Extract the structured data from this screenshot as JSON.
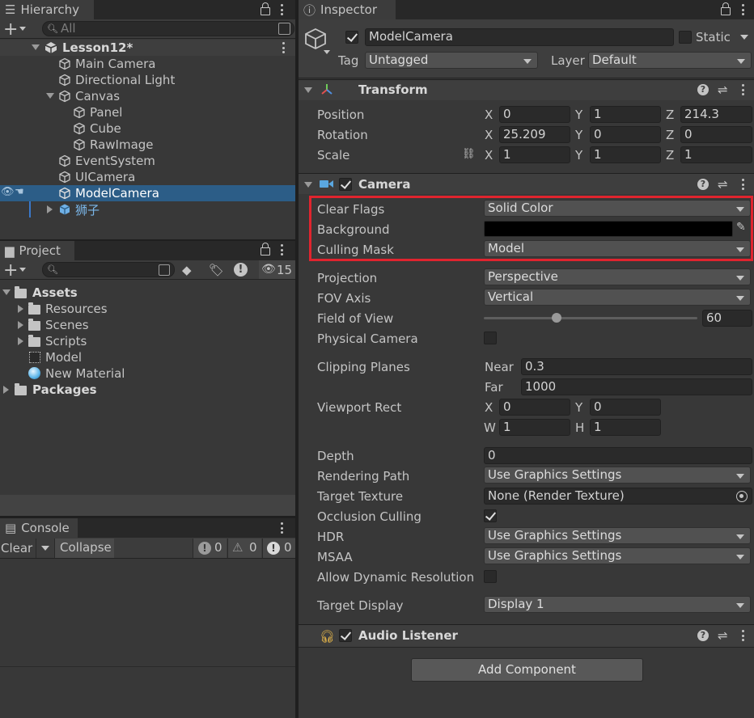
{
  "hierarchy": {
    "tab": "Hierarchy",
    "search_placeholder": "All",
    "scene": "Lesson12*",
    "items": [
      {
        "label": "Main Camera"
      },
      {
        "label": "Directional Light"
      },
      {
        "label": "Canvas"
      },
      {
        "label": "Panel"
      },
      {
        "label": "Cube"
      },
      {
        "label": "RawImage"
      },
      {
        "label": "EventSystem"
      },
      {
        "label": "UICamera"
      },
      {
        "label": "ModelCamera"
      },
      {
        "label": "狮子"
      }
    ]
  },
  "project": {
    "tab": "Project",
    "hidden_count": "15",
    "items": [
      {
        "label": "Assets"
      },
      {
        "label": "Resources"
      },
      {
        "label": "Scenes"
      },
      {
        "label": "Scripts"
      },
      {
        "label": "Model"
      },
      {
        "label": "New Material"
      },
      {
        "label": "Packages"
      }
    ]
  },
  "console": {
    "tab": "Console",
    "clear": "Clear",
    "collapse": "Collapse",
    "errors": "0",
    "warnings": "0",
    "messages": "0"
  },
  "inspector": {
    "tab": "Inspector",
    "object_name": "ModelCamera",
    "static_label": "Static",
    "tag_label": "Tag",
    "tag_value": "Untagged",
    "layer_label": "Layer",
    "layer_value": "Default",
    "transform": {
      "title": "Transform",
      "position_label": "Position",
      "rotation_label": "Rotation",
      "scale_label": "Scale",
      "axis_x": "X",
      "axis_y": "Y",
      "axis_z": "Z",
      "position": {
        "x": "0",
        "y": "1",
        "z": "214.3"
      },
      "rotation": {
        "x": "25.209",
        "y": "0",
        "z": "0"
      },
      "scale": {
        "x": "1",
        "y": "1",
        "z": "1"
      }
    },
    "camera": {
      "title": "Camera",
      "clear_flags_label": "Clear Flags",
      "clear_flags": "Solid Color",
      "background_label": "Background",
      "culling_mask_label": "Culling Mask",
      "culling_mask": "Model",
      "projection_label": "Projection",
      "projection": "Perspective",
      "fov_axis_label": "FOV Axis",
      "fov_axis": "Vertical",
      "fov_label": "Field of View",
      "fov_value": "60",
      "fov_slider_fraction": 0.34,
      "physical_label": "Physical Camera",
      "clipping_label": "Clipping Planes",
      "near_label": "Near",
      "near": "0.3",
      "far_label": "Far",
      "far": "1000",
      "viewport_label": "Viewport Rect",
      "vp_x_label": "X",
      "vp_y_label": "Y",
      "vp_w_label": "W",
      "vp_h_label": "H",
      "vp_x": "0",
      "vp_y": "0",
      "vp_w": "1",
      "vp_h": "1",
      "depth_label": "Depth",
      "depth": "0",
      "rendering_path_label": "Rendering Path",
      "rendering_path": "Use Graphics Settings",
      "target_texture_label": "Target Texture",
      "target_texture": "None (Render Texture)",
      "occlusion_label": "Occlusion Culling",
      "hdr_label": "HDR",
      "hdr": "Use Graphics Settings",
      "msaa_label": "MSAA",
      "msaa": "Use Graphics Settings",
      "dynres_label": "Allow Dynamic Resolution",
      "target_display_label": "Target Display",
      "target_display": "Display 1"
    },
    "audio_listener": {
      "title": "Audio Listener"
    },
    "add_component": "Add Component"
  },
  "colors": {
    "selection": "#2c5d87",
    "highlight_box": "#e0242e",
    "background_color": "#000000"
  }
}
